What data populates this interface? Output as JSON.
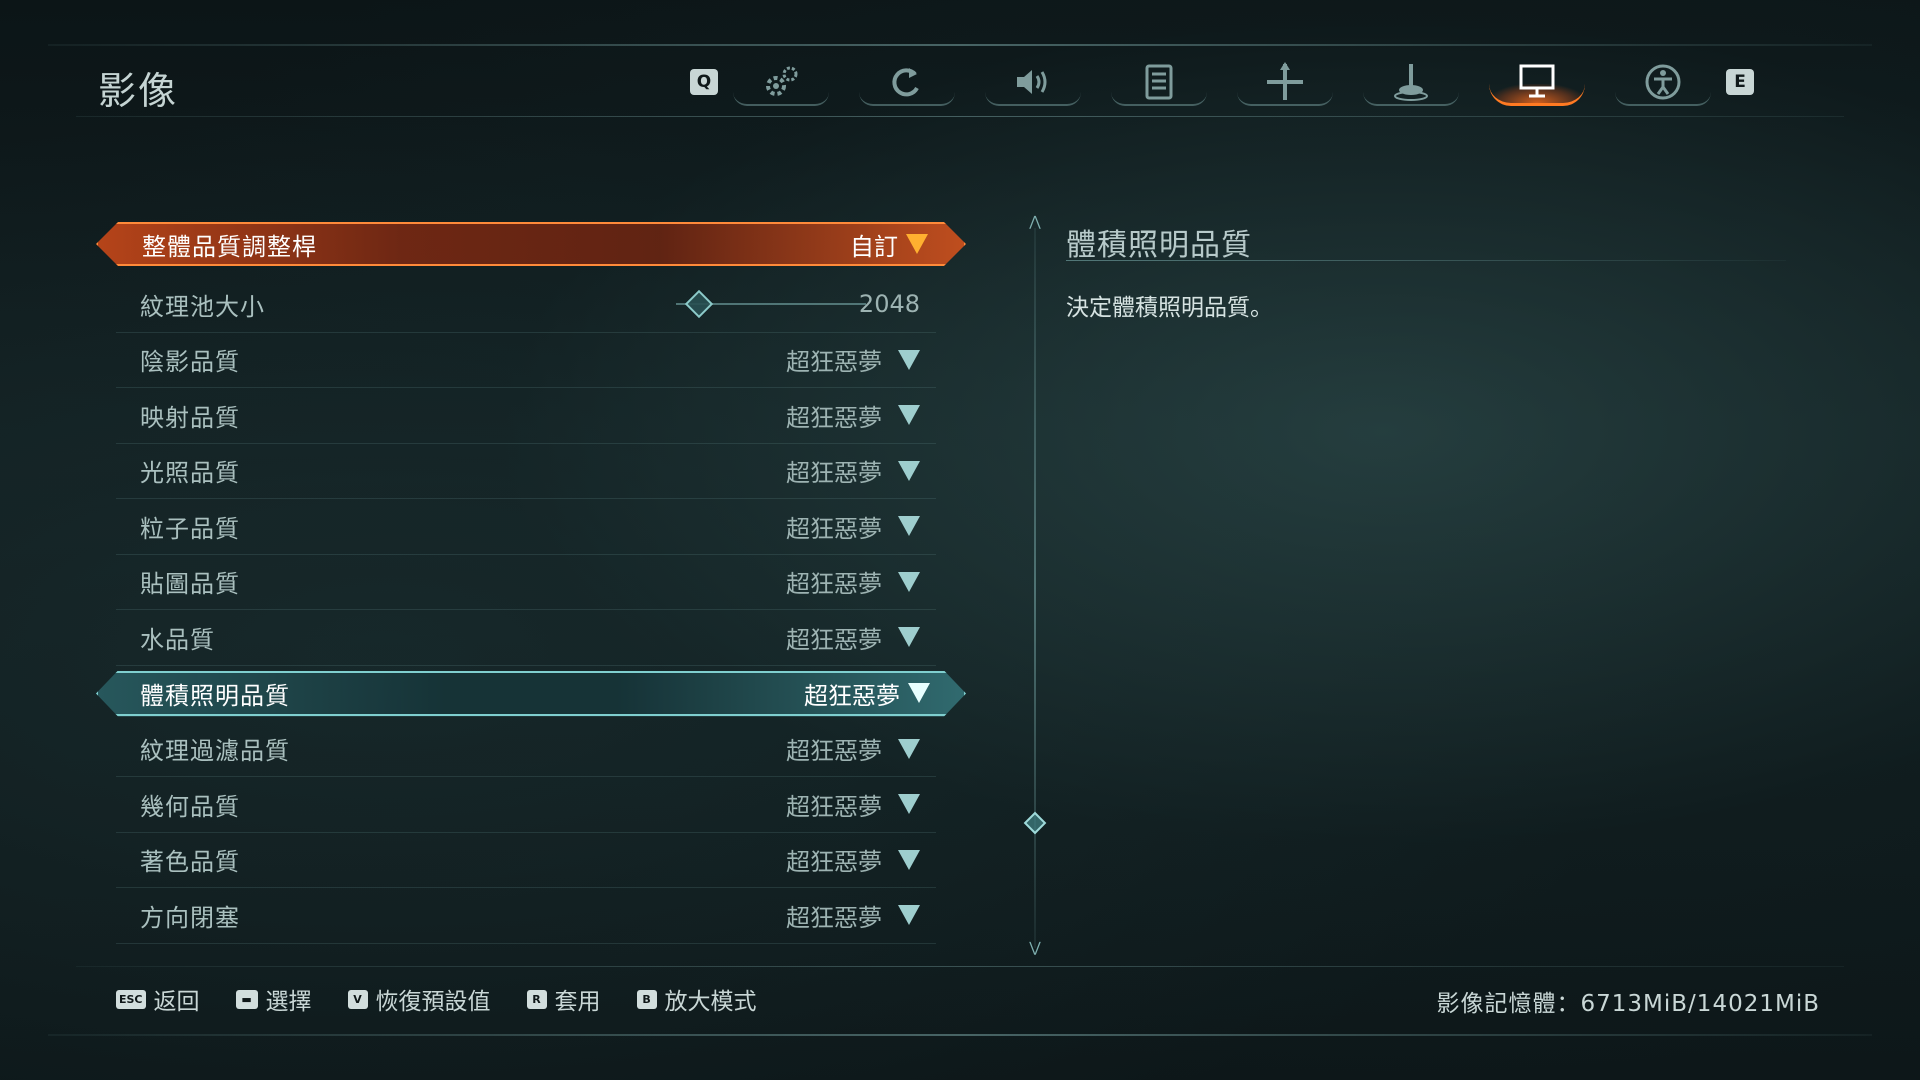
{
  "header": {
    "title": "影像",
    "left_key": "Q",
    "right_key": "E",
    "tabs": [
      {
        "icon": "gear-icon",
        "active": false
      },
      {
        "icon": "refresh-icon",
        "active": false
      },
      {
        "icon": "speaker-icon",
        "active": false
      },
      {
        "icon": "list-icon",
        "active": false
      },
      {
        "icon": "crosshair-icon",
        "active": false
      },
      {
        "icon": "joystick-icon",
        "active": false
      },
      {
        "icon": "monitor-icon",
        "active": true
      },
      {
        "icon": "accessibility-icon",
        "active": false
      }
    ]
  },
  "settings": {
    "rows": [
      {
        "label": "整體品質調整桿",
        "value": "自訂"
      },
      {
        "label": "紋理池大小",
        "value": "2048"
      },
      {
        "label": "陰影品質",
        "value": "超狂惡夢"
      },
      {
        "label": "映射品質",
        "value": "超狂惡夢"
      },
      {
        "label": "光照品質",
        "value": "超狂惡夢"
      },
      {
        "label": "粒子品質",
        "value": "超狂惡夢"
      },
      {
        "label": "貼圖品質",
        "value": "超狂惡夢"
      },
      {
        "label": "水品質",
        "value": "超狂惡夢"
      },
      {
        "label": "體積照明品質",
        "value": "超狂惡夢"
      },
      {
        "label": "紋理過濾品質",
        "value": "超狂惡夢"
      },
      {
        "label": "幾何品質",
        "value": "超狂惡夢"
      },
      {
        "label": "著色品質",
        "value": "超狂惡夢"
      },
      {
        "label": "方向閉塞",
        "value": "超狂惡夢"
      }
    ]
  },
  "description": {
    "title": "體積照明品質",
    "text": "決定體積照明品質。"
  },
  "footer": {
    "actions": [
      {
        "key": "ESC",
        "label": "返回"
      },
      {
        "key": "▬",
        "label": "選擇"
      },
      {
        "key": "V",
        "label": "恢復預設值"
      },
      {
        "key": "R",
        "label": "套用"
      },
      {
        "key": "B",
        "label": "放大模式"
      }
    ],
    "vram": "影像記憶體：6713MiB/14021MiB"
  },
  "colors": {
    "accent_orange": "#ff7a22",
    "accent_teal": "#7fcfcf"
  }
}
